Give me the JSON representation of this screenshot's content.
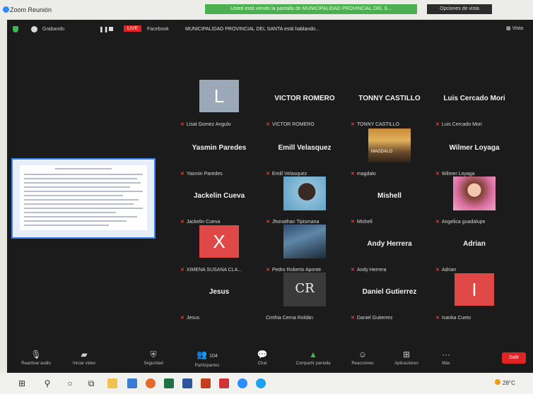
{
  "window": {
    "title": "Zoom Reunión"
  },
  "banner": {
    "share_text": "Usted está viendo la pantalla de MUNICIPALIDAD PROVINCIAL DEL S...",
    "view_options": "Opciones de vista"
  },
  "topbar": {
    "stop_label": "Grabando",
    "live": "LIVE",
    "platform": "Facebook",
    "speaking": "MUNICIPALIDAD PROVINCIAL DEL SANTA está hablando...",
    "view": "Vista"
  },
  "participants": [
    {
      "name": "Lisat Gomez Angulo",
      "big": "",
      "initial": "L",
      "avatar_color": "#9aa8b8"
    },
    {
      "name": "VICTOR ROMERO",
      "big": "VICTOR ROMERO",
      "initial": "",
      "avatar_color": ""
    },
    {
      "name": "TONNY CASTILLO",
      "big": "TONNY CASTILLO",
      "initial": "",
      "avatar_color": ""
    },
    {
      "name": "Luis Cercado Mori",
      "big": "Luis Cercado Mori",
      "initial": "",
      "avatar_color": ""
    },
    {
      "name": "Yasmin Paredes",
      "big": "Yasmin Paredes",
      "initial": "",
      "avatar_color": ""
    },
    {
      "name": "Emill Velasquez",
      "big": "Emill  Velasquez",
      "initial": "",
      "avatar_color": ""
    },
    {
      "name": "magdalo",
      "big": "",
      "initial": "",
      "avatar_color": ""
    },
    {
      "name": "Wilmer Loyaga",
      "big": "Wilmer Loyaga",
      "initial": "",
      "avatar_color": ""
    },
    {
      "name": "Jackelin Cueva",
      "big": "Jackelin Cueva",
      "initial": "",
      "avatar_color": ""
    },
    {
      "name": "Jhonathan Tipismana",
      "big": "",
      "initial": "",
      "avatar_color": ""
    },
    {
      "name": "Mishell",
      "big": "Mishell",
      "initial": "",
      "avatar_color": ""
    },
    {
      "name": "Angelica guadalupe",
      "big": "",
      "initial": "",
      "avatar_color": ""
    },
    {
      "name": "XIMENA SUSANA CLA...",
      "big": "",
      "initial": "X",
      "avatar_color": "#e04848"
    },
    {
      "name": "Pedro Roberto Aponte",
      "big": "",
      "initial": "",
      "avatar_color": ""
    },
    {
      "name": "Andy Herrera",
      "big": "Andy Herrera",
      "initial": "",
      "avatar_color": ""
    },
    {
      "name": "Adrian",
      "big": "Adrian",
      "initial": "",
      "avatar_color": ""
    },
    {
      "name": "Jesus",
      "big": "Jesus",
      "initial": "",
      "avatar_color": ""
    },
    {
      "name": "Cinthia Cerna Roldán",
      "big": "",
      "initial": "",
      "avatar_color": ""
    },
    {
      "name": "Daniel Gutierrez",
      "big": "Daniel Gutierrez",
      "initial": "",
      "avatar_color": ""
    },
    {
      "name": "Ivanka Cueto",
      "big": "",
      "initial": "I",
      "avatar_color": "#e04848"
    }
  ],
  "photos": {
    "magdalo_overlay": "MAGDALO",
    "cinthia_logo": "CR"
  },
  "toolbar": {
    "audio": "Reactivar audio",
    "video": "Iniciar video",
    "security": "Seguridad",
    "participants": "Participantes",
    "participant_count": "104",
    "chat": "Chat",
    "share": "Compartir pantalla",
    "reactions": "Reacciones",
    "apps": "Aplicaciones",
    "more": "Más",
    "leave": "Salir"
  },
  "taskbar": {
    "weather": "28°C"
  },
  "colors": {
    "live": "#e02424",
    "share_banner": "#4caf50",
    "leave": "#e02424",
    "meeting_bg": "#1b1b1b"
  }
}
